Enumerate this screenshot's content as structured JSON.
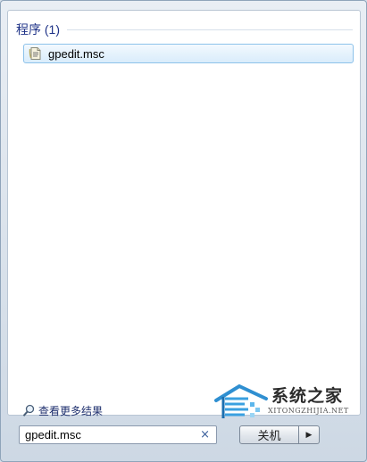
{
  "results": {
    "group_title": "程序 (1)",
    "items": [
      {
        "label": "gpedit.msc",
        "icon": "document-file-icon"
      }
    ]
  },
  "see_more": {
    "label": "查看更多结果",
    "icon": "search-icon"
  },
  "search": {
    "value": "gpedit.msc",
    "clear_icon": "×"
  },
  "power": {
    "shutdown_label": "关机",
    "arrow": "▶"
  },
  "watermark": {
    "text": "系统之家",
    "subtext": "XITONGZHIJIA.NET"
  }
}
